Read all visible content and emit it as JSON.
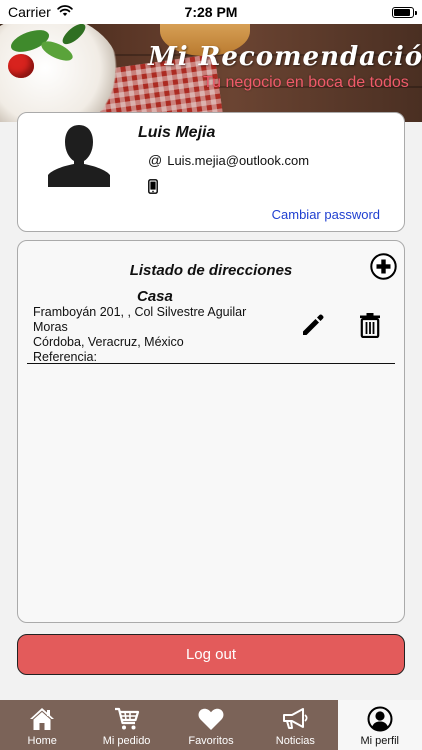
{
  "status_bar": {
    "carrier": "Carrier",
    "time": "7:28 PM"
  },
  "header": {
    "brand": "Mi Recomendación",
    "tagline": "Tu negocio en boca de todos"
  },
  "profile": {
    "name": "Luis Mejia",
    "email_symbol": "@",
    "email": "Luis.mejia@outlook.com",
    "change_password": "Cambiar password"
  },
  "addresses": {
    "title": "Listado de direcciones",
    "items": [
      {
        "name": "Casa",
        "line1": "Framboyán 201, , Col Silvestre Aguilar Moras",
        "line2": "Córdoba, Veracruz, México",
        "line3": "Referencia:"
      }
    ]
  },
  "logout_label": "Log out",
  "tabs": [
    {
      "label": "Home",
      "icon": "home-icon"
    },
    {
      "label": "Mi pedido",
      "icon": "cart-icon"
    },
    {
      "label": "Favoritos",
      "icon": "heart-icon"
    },
    {
      "label": "Noticias",
      "icon": "megaphone-icon"
    },
    {
      "label": "Mi perfil",
      "icon": "user-circle-icon",
      "active": true
    }
  ],
  "colors": {
    "tab_bg": "#7b6358",
    "logout": "#e35b5b",
    "link": "#1f3fd0",
    "tagline": "#ef5a6a"
  }
}
